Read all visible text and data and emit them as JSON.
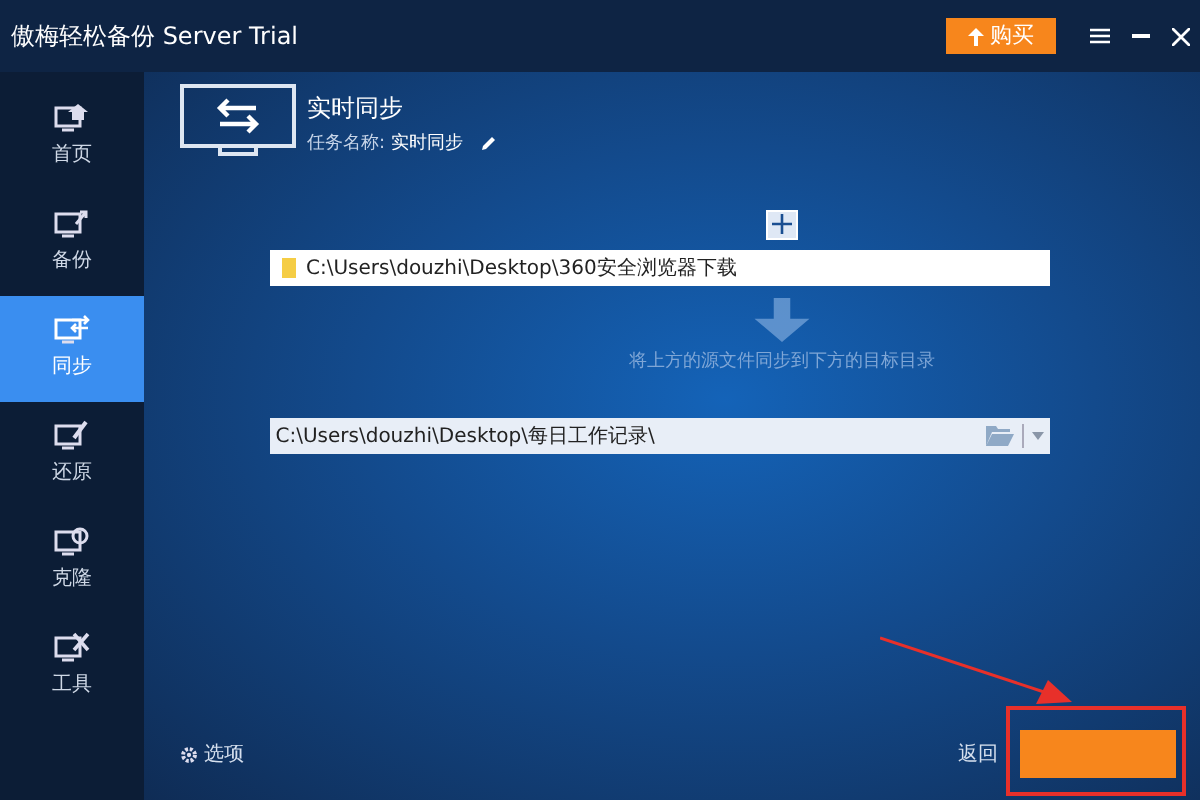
{
  "window": {
    "title": "傲梅轻松备份 Server Trial",
    "buy_button": "购买"
  },
  "sidebar": {
    "items": [
      {
        "label": "首页",
        "kind": "home",
        "selected": false
      },
      {
        "label": "备份",
        "kind": "backup",
        "selected": false
      },
      {
        "label": "同步",
        "kind": "sync",
        "selected": true
      },
      {
        "label": "还原",
        "kind": "restore",
        "selected": false
      },
      {
        "label": "克隆",
        "kind": "clone",
        "selected": false
      },
      {
        "label": "工具",
        "kind": "tools",
        "selected": false
      }
    ]
  },
  "header": {
    "title": "实时同步",
    "task_name_label": "任务名称:",
    "task_name": "实时同步"
  },
  "source": {
    "path": "C:\\Users\\douzhi\\Desktop\\360安全浏览器下载"
  },
  "hint": "将上方的源文件同步到下方的目标目录",
  "destination": {
    "path": "C:\\Users\\douzhi\\Desktop\\每日工作记录\\"
  },
  "footer": {
    "options": "选项",
    "back": "返回"
  }
}
